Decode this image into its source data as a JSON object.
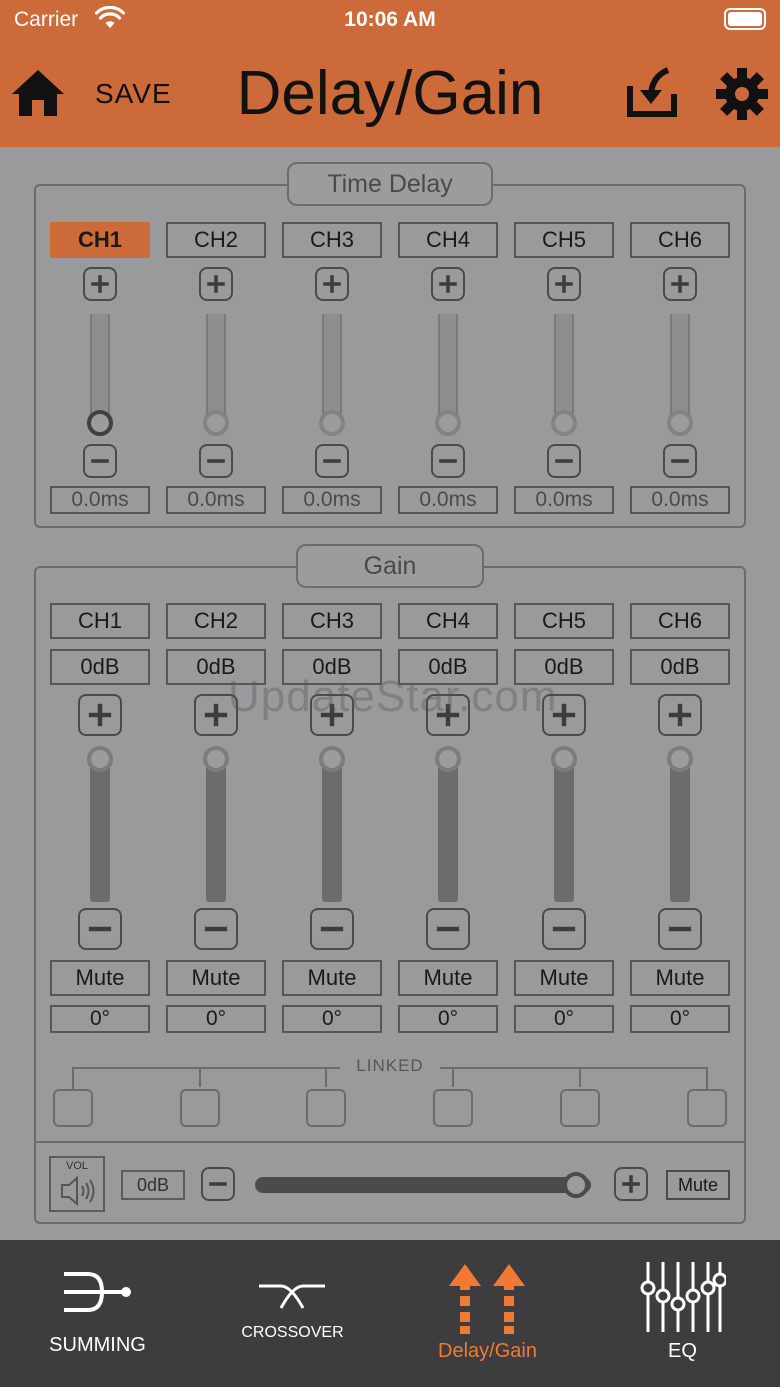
{
  "status": {
    "carrier": "Carrier",
    "time": "10:06 AM"
  },
  "header": {
    "save": "SAVE",
    "title": "Delay/Gain"
  },
  "time_delay": {
    "title": "Time Delay",
    "channels": [
      {
        "label": "CH1",
        "value": "0.0ms",
        "active": true
      },
      {
        "label": "CH2",
        "value": "0.0ms"
      },
      {
        "label": "CH3",
        "value": "0.0ms"
      },
      {
        "label": "CH4",
        "value": "0.0ms"
      },
      {
        "label": "CH5",
        "value": "0.0ms"
      },
      {
        "label": "CH6",
        "value": "0.0ms"
      }
    ]
  },
  "gain": {
    "title": "Gain",
    "channels": [
      {
        "label": "CH1",
        "db": "0dB",
        "mute": "Mute",
        "phase": "0°"
      },
      {
        "label": "CH2",
        "db": "0dB",
        "mute": "Mute",
        "phase": "0°"
      },
      {
        "label": "CH3",
        "db": "0dB",
        "mute": "Mute",
        "phase": "0°"
      },
      {
        "label": "CH4",
        "db": "0dB",
        "mute": "Mute",
        "phase": "0°"
      },
      {
        "label": "CH5",
        "db": "0dB",
        "mute": "Mute",
        "phase": "0°"
      },
      {
        "label": "CH6",
        "db": "0dB",
        "mute": "Mute",
        "phase": "0°"
      }
    ],
    "linked_label": "LINKED"
  },
  "volume": {
    "icon_label": "VOL",
    "db": "0dB",
    "mute": "Mute",
    "level": 1.0
  },
  "watermark": "UpdateStar.com",
  "tabs": [
    {
      "label": "SUMMING"
    },
    {
      "label": "CROSSOVER"
    },
    {
      "label": "Delay/Gain",
      "active": true
    },
    {
      "label": "EQ"
    }
  ],
  "colors": {
    "accent": "#cd6a3a",
    "background": "#999a9c",
    "tabbar": "#3d3d3f"
  }
}
